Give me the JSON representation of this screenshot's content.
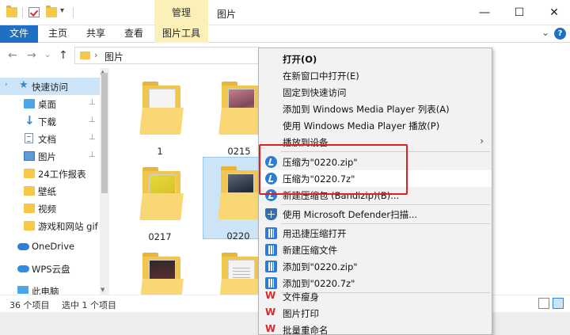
{
  "titlebar": {
    "context_tab": "管理",
    "title": "图片",
    "minimize": "—",
    "maximize": "☐",
    "close": "✕"
  },
  "ribbon": {
    "tabs": [
      "文件",
      "主页",
      "共享",
      "查看",
      "图片工具"
    ],
    "expand": "⌄",
    "help": "?"
  },
  "address": {
    "back": "←",
    "forward": "→",
    "recent": "⌄",
    "up": "↑",
    "chevron": "›",
    "path": "图片"
  },
  "sidebar": {
    "items": [
      {
        "label": "快速访问",
        "icon": "star-icon",
        "selected": true
      },
      {
        "label": "桌面",
        "icon": "desktop-icon",
        "pinned": true
      },
      {
        "label": "下载",
        "icon": "download-icon",
        "pinned": true
      },
      {
        "label": "文档",
        "icon": "document-icon",
        "pinned": true
      },
      {
        "label": "图片",
        "icon": "pictures-icon",
        "pinned": true
      },
      {
        "label": "24工作报表",
        "icon": "folder-icon"
      },
      {
        "label": "壁纸",
        "icon": "folder-icon"
      },
      {
        "label": "视频",
        "icon": "folder-icon"
      },
      {
        "label": "游戏和网站 gif",
        "icon": "folder-icon"
      },
      {
        "label": "OneDrive",
        "icon": "onedrive-icon"
      },
      {
        "label": "WPS云盘",
        "icon": "wps-cloud-icon"
      },
      {
        "label": "此电脑",
        "icon": "this-pc-icon"
      }
    ],
    "pin_glyph": "📌"
  },
  "files": [
    {
      "name": "1",
      "paper": "p-white"
    },
    {
      "name": "0215",
      "paper": "p-pink"
    },
    {
      "name": "0217",
      "paper": "p-yellow"
    },
    {
      "name": "0220",
      "paper": "p-dark",
      "selected": true
    },
    {
      "name": "",
      "paper": "p-red"
    },
    {
      "name": "",
      "paper": "p-doc"
    }
  ],
  "status": {
    "count": "36 个项目",
    "selected": "选中 1 个项目"
  },
  "context_menu": {
    "items": [
      {
        "label": "打开(O)",
        "bold": true
      },
      {
        "label": "在新窗口中打开(E)"
      },
      {
        "label": "固定到快速访问"
      },
      {
        "label": "添加到 Windows Media Player 列表(A)"
      },
      {
        "label": "使用 Windows Media Player 播放(P)"
      },
      {
        "label": "播放到设备",
        "submenu": "›"
      },
      {
        "label": "压缩为\"0220.zip\"",
        "icon": "bandizip-icon"
      },
      {
        "label": "压缩为\"0220.7z\"",
        "icon": "bandizip-icon",
        "hover": true
      },
      {
        "label": "新建压缩包 (Bandizip)(B)...",
        "icon": "bandizip-icon"
      },
      {
        "label": "使用 Microsoft Defender扫描...",
        "icon": "defender-icon"
      },
      {
        "label": "用迅捷压缩打开",
        "icon": "xunjie-icon"
      },
      {
        "label": "新建压缩文件",
        "icon": "xunjie-icon"
      },
      {
        "label": "添加到\"0220.zip\"",
        "icon": "xunjie-icon"
      },
      {
        "label": "添加到\"0220.7z\"",
        "icon": "xunjie-icon"
      },
      {
        "label": "文件瘦身",
        "icon": "wps-icon"
      },
      {
        "label": "图片打印",
        "icon": "wps-icon"
      },
      {
        "label": "批量重命名",
        "icon": "wps-icon"
      }
    ],
    "wps_glyph": "W"
  },
  "colors": {
    "accent": "#1f6fc5",
    "selection": "#cce4f7",
    "highlight_box": "#e02020"
  }
}
